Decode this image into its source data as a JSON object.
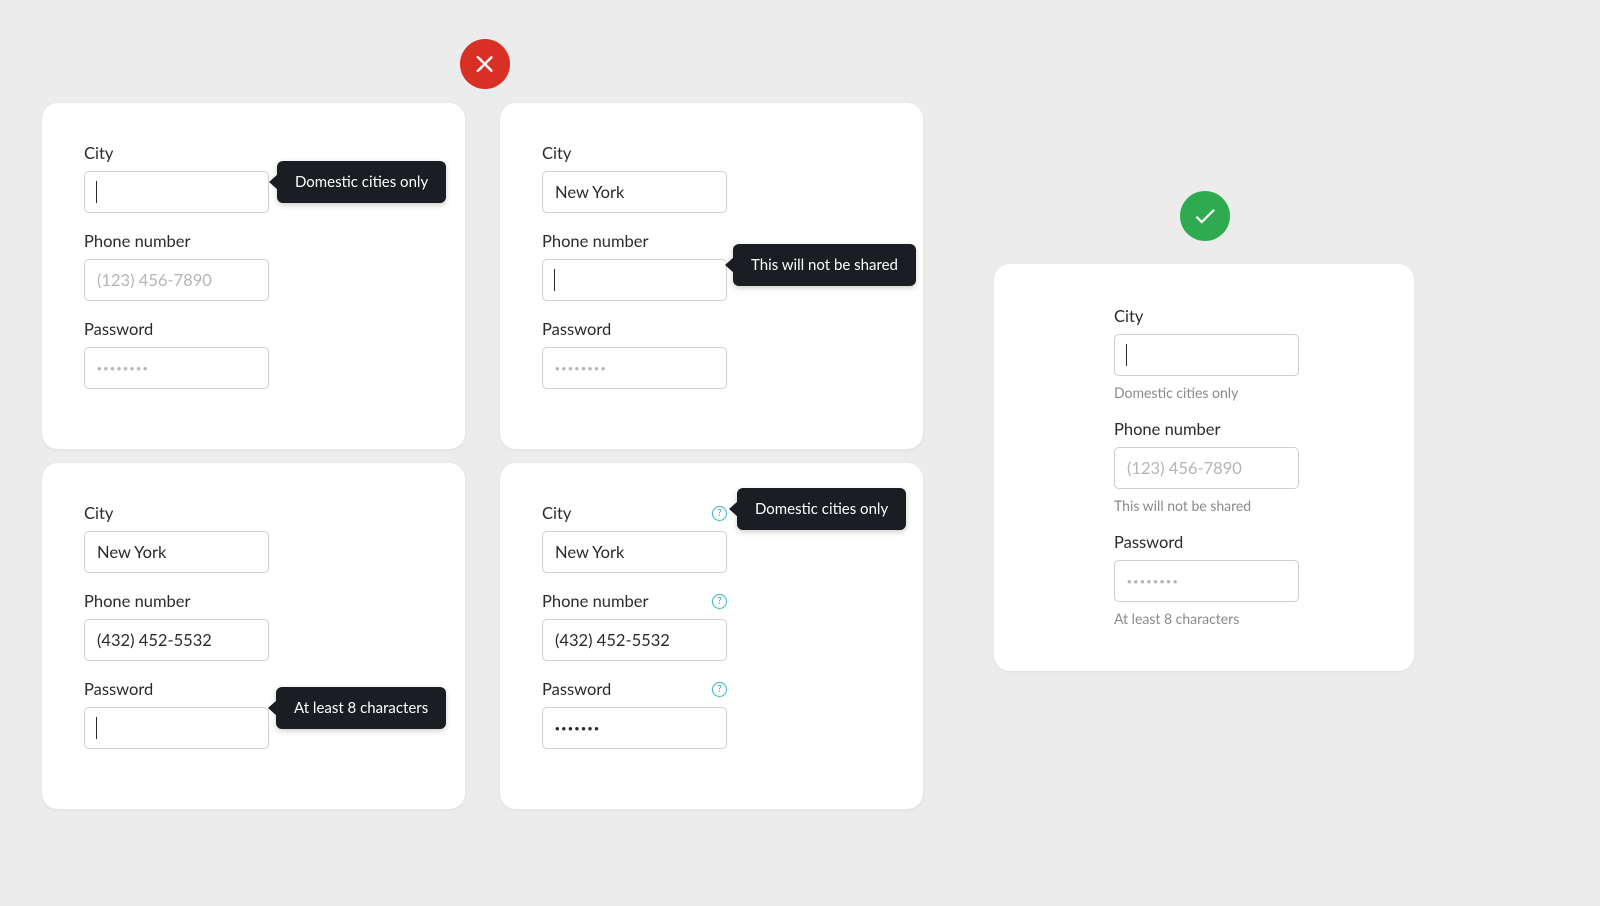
{
  "colors": {
    "error": "#d93025",
    "success": "#2eab50",
    "tooltipBg": "#1a1d21",
    "helpIcon": "#3eb2c2"
  },
  "labels": {
    "city": "City",
    "phone": "Phone number",
    "password": "Password"
  },
  "hints": {
    "city": "Domestic cities only",
    "phone": "This will not be shared",
    "password": "At least 8 characters"
  },
  "placeholders": {
    "phone": "(123) 456-7890",
    "passwordDots": "••••••••"
  },
  "values": {
    "cityNY": "New York",
    "phoneFilled": "(432) 452-5532",
    "passwordMasked7": "•••••••"
  },
  "badTooltips": {
    "card1_city": "Domestic cities only",
    "card2_phone": "This will not be shared",
    "card3_password": "At least 8 characters",
    "card4_city": "Domestic cities only"
  }
}
